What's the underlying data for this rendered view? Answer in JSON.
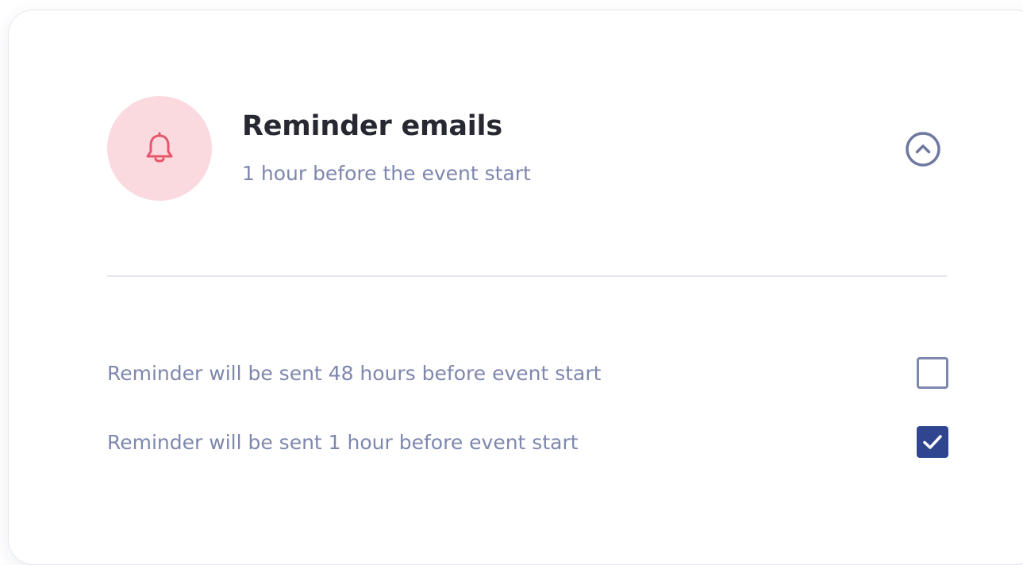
{
  "reminder": {
    "title": "Reminder emails",
    "subtitle": "1 hour before the event start",
    "icon": "bell-icon",
    "collapse_icon": "chevron-up-circle-icon",
    "expanded": true
  },
  "options": [
    {
      "label": "Reminder will be sent 48 hours before event start",
      "checked": false
    },
    {
      "label": "Reminder will be sent 1 hour before event start",
      "checked": true
    }
  ],
  "colors": {
    "accent": "#2f4590",
    "bell": "#e8566b",
    "bell_background": "#fadadf",
    "muted_text": "#7e87ad",
    "title_text": "#272832"
  }
}
